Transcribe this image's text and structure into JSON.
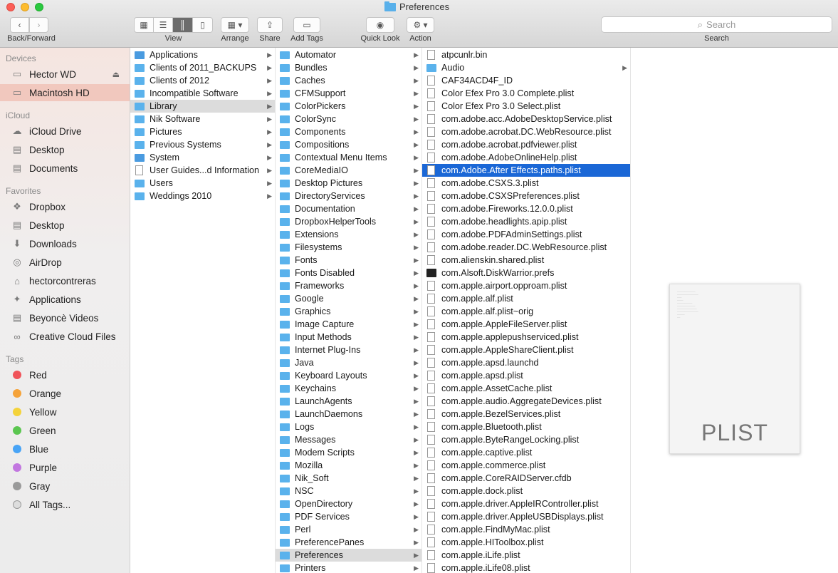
{
  "window": {
    "title": "Preferences"
  },
  "toolbar": {
    "back_forward_label": "Back/Forward",
    "view_label": "View",
    "arrange_label": "Arrange",
    "share_label": "Share",
    "add_tags_label": "Add Tags",
    "quick_look_label": "Quick Look",
    "action_label": "Action",
    "search_placeholder": "Search",
    "search_label": "Search"
  },
  "sidebar": {
    "devices_header": "Devices",
    "devices": [
      {
        "label": "Hector WD",
        "icon": "disk-icon"
      },
      {
        "label": "Macintosh HD",
        "icon": "disk-icon",
        "selected": true
      }
    ],
    "icloud_header": "iCloud",
    "icloud": [
      {
        "label": "iCloud Drive",
        "icon": "cloud-icon"
      },
      {
        "label": "Desktop",
        "icon": "desktop-icon"
      },
      {
        "label": "Documents",
        "icon": "document-icon"
      }
    ],
    "favorites_header": "Favorites",
    "favorites": [
      {
        "label": "Dropbox",
        "icon": "dropbox-icon"
      },
      {
        "label": "Desktop",
        "icon": "desktop-icon"
      },
      {
        "label": "Downloads",
        "icon": "download-icon"
      },
      {
        "label": "AirDrop",
        "icon": "airdrop-icon"
      },
      {
        "label": "hectorcontreras",
        "icon": "home-icon"
      },
      {
        "label": "Applications",
        "icon": "applications-icon"
      },
      {
        "label": "Beyoncè Videos",
        "icon": "folder-icon"
      },
      {
        "label": "Creative Cloud Files",
        "icon": "creative-cloud-icon"
      }
    ],
    "tags_header": "Tags",
    "tags": [
      {
        "label": "Red",
        "color": "#f0545a"
      },
      {
        "label": "Orange",
        "color": "#f5a33a"
      },
      {
        "label": "Yellow",
        "color": "#f4d33b"
      },
      {
        "label": "Green",
        "color": "#5bc650"
      },
      {
        "label": "Blue",
        "color": "#48a4f6"
      },
      {
        "label": "Purple",
        "color": "#c277e0"
      },
      {
        "label": "Gray",
        "color": "#9a9a9a"
      },
      {
        "label": "All Tags...",
        "color": ""
      }
    ]
  },
  "column1": [
    {
      "name": "Applications",
      "type": "app"
    },
    {
      "name": "Clients of 2011_BACKUPS",
      "type": "folder"
    },
    {
      "name": "Clients of 2012",
      "type": "folder"
    },
    {
      "name": "Incompatible Software",
      "type": "folder"
    },
    {
      "name": "Library",
      "type": "folder",
      "highlighted": true
    },
    {
      "name": "Nik Software",
      "type": "folder"
    },
    {
      "name": "Pictures",
      "type": "folder"
    },
    {
      "name": "Previous Systems",
      "type": "folder"
    },
    {
      "name": "System",
      "type": "app"
    },
    {
      "name": "User Guides...d Information",
      "type": "doc"
    },
    {
      "name": "Users",
      "type": "folder"
    },
    {
      "name": "Weddings 2010",
      "type": "folder"
    }
  ],
  "column2": [
    "Automator",
    "Bundles",
    "Caches",
    "CFMSupport",
    "ColorPickers",
    "ColorSync",
    "Components",
    "Compositions",
    "Contextual Menu Items",
    "CoreMediaIO",
    "Desktop Pictures",
    "DirectoryServices",
    "Documentation",
    "DropboxHelperTools",
    "Extensions",
    "Filesystems",
    "Fonts",
    "Fonts Disabled",
    "Frameworks",
    "Google",
    "Graphics",
    "Image Capture",
    "Input Methods",
    "Internet Plug-Ins",
    "Java",
    "Keyboard Layouts",
    "Keychains",
    "LaunchAgents",
    "LaunchDaemons",
    "Logs",
    "Messages",
    "Modem Scripts",
    "Mozilla",
    "Nik_Soft",
    "NSC",
    "OpenDirectory",
    "PDF Services",
    "Perl",
    "PreferencePanes",
    "Preferences",
    "Printers"
  ],
  "column2_highlighted": "Preferences",
  "column3": [
    {
      "name": "atpcunlr.bin",
      "type": "doc"
    },
    {
      "name": "Audio",
      "type": "folder"
    },
    {
      "name": "CAF34ACD4F_ID",
      "type": "doc"
    },
    {
      "name": "Color Efex Pro 3.0 Complete.plist",
      "type": "doc"
    },
    {
      "name": "Color Efex Pro 3.0 Select.plist",
      "type": "doc"
    },
    {
      "name": "com.adobe.acc.AdobeDesktopService.plist",
      "type": "doc"
    },
    {
      "name": "com.adobe.acrobat.DC.WebResource.plist",
      "type": "doc"
    },
    {
      "name": "com.adobe.acrobat.pdfviewer.plist",
      "type": "doc"
    },
    {
      "name": "com.adobe.AdobeOnlineHelp.plist",
      "type": "doc"
    },
    {
      "name": "com.Adobe.After Effects.paths.plist",
      "type": "doc",
      "selected": true
    },
    {
      "name": "com.adobe.CSXS.3.plist",
      "type": "doc"
    },
    {
      "name": "com.adobe.CSXSPreferences.plist",
      "type": "doc"
    },
    {
      "name": "com.adobe.Fireworks.12.0.0.plist",
      "type": "doc"
    },
    {
      "name": "com.adobe.headlights.apip.plist",
      "type": "doc"
    },
    {
      "name": "com.adobe.PDFAdminSettings.plist",
      "type": "doc"
    },
    {
      "name": "com.adobe.reader.DC.WebResource.plist",
      "type": "doc"
    },
    {
      "name": "com.alienskin.shared.plist",
      "type": "doc"
    },
    {
      "name": "com.Alsoft.DiskWarrior.prefs",
      "type": "blk"
    },
    {
      "name": "com.apple.airport.opproam.plist",
      "type": "doc"
    },
    {
      "name": "com.apple.alf.plist",
      "type": "doc"
    },
    {
      "name": "com.apple.alf.plist~orig",
      "type": "doc"
    },
    {
      "name": "com.apple.AppleFileServer.plist",
      "type": "doc"
    },
    {
      "name": "com.apple.applepushserviced.plist",
      "type": "doc"
    },
    {
      "name": "com.apple.AppleShareClient.plist",
      "type": "doc"
    },
    {
      "name": "com.apple.apsd.launchd",
      "type": "doc"
    },
    {
      "name": "com.apple.apsd.plist",
      "type": "doc"
    },
    {
      "name": "com.apple.AssetCache.plist",
      "type": "doc"
    },
    {
      "name": "com.apple.audio.AggregateDevices.plist",
      "type": "doc"
    },
    {
      "name": "com.apple.BezelServices.plist",
      "type": "doc"
    },
    {
      "name": "com.apple.Bluetooth.plist",
      "type": "doc"
    },
    {
      "name": "com.apple.ByteRangeLocking.plist",
      "type": "doc"
    },
    {
      "name": "com.apple.captive.plist",
      "type": "doc"
    },
    {
      "name": "com.apple.commerce.plist",
      "type": "doc"
    },
    {
      "name": "com.apple.CoreRAIDServer.cfdb",
      "type": "doc"
    },
    {
      "name": "com.apple.dock.plist",
      "type": "doc"
    },
    {
      "name": "com.apple.driver.AppleIRController.plist",
      "type": "doc"
    },
    {
      "name": "com.apple.driver.AppleUSBDisplays.plist",
      "type": "doc"
    },
    {
      "name": "com.apple.FindMyMac.plist",
      "type": "doc"
    },
    {
      "name": "com.apple.HIToolbox.plist",
      "type": "doc"
    },
    {
      "name": "com.apple.iLife.plist",
      "type": "doc"
    },
    {
      "name": "com.apple.iLife08.plist",
      "type": "doc"
    }
  ],
  "preview": {
    "file_type_label": "PLIST"
  }
}
